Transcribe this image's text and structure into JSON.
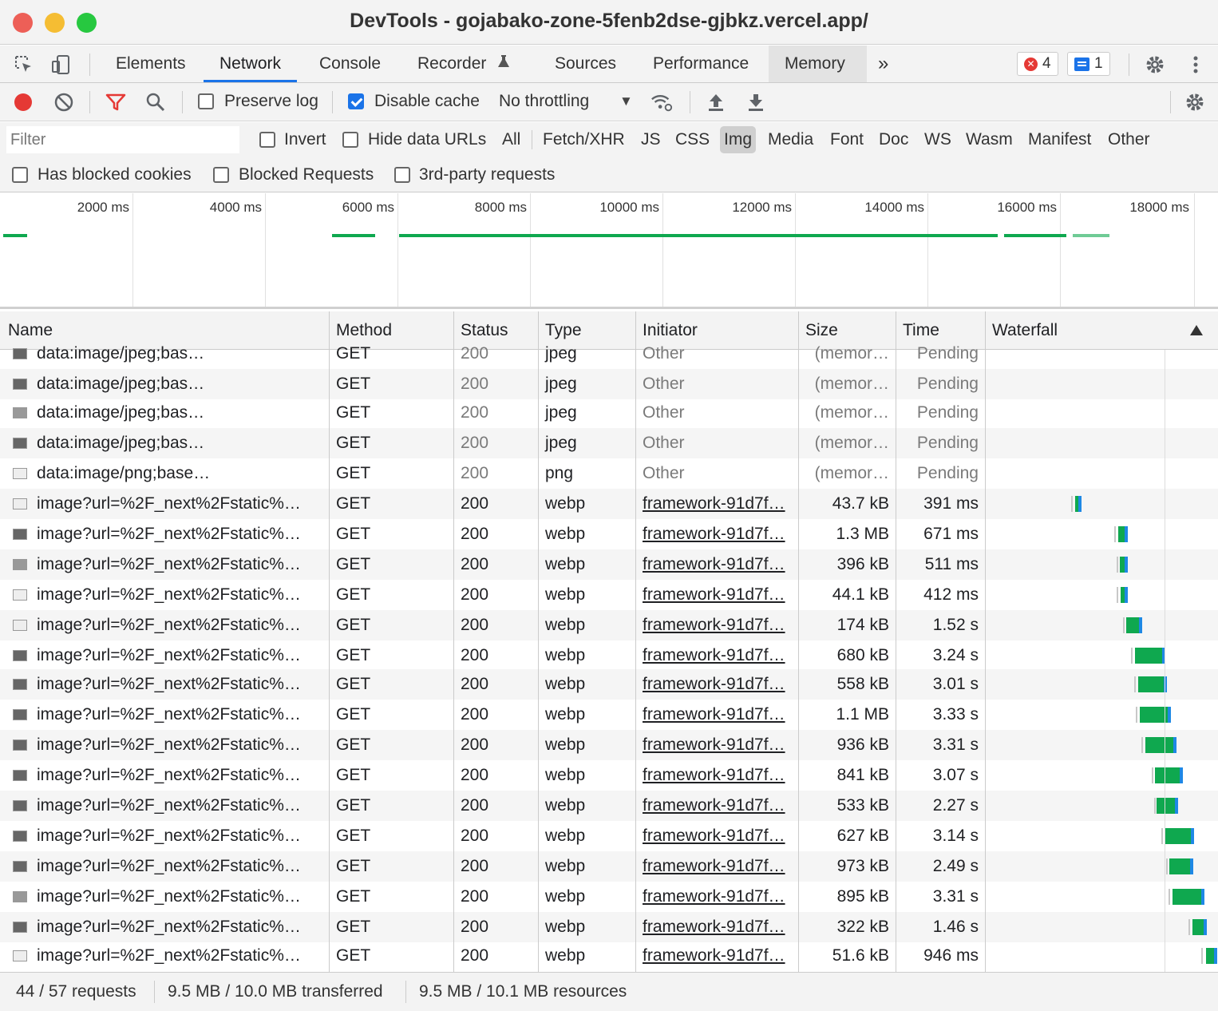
{
  "window": {
    "title": "DevTools - gojabako-zone-5fenb2dse-gjbkz.vercel.app/"
  },
  "tabs": [
    "Elements",
    "Network",
    "Console",
    "Recorder",
    "Sources",
    "Performance",
    "Memory"
  ],
  "tab_active": "Network",
  "more_tabs": "»",
  "badges": {
    "errors": "4",
    "messages": "1"
  },
  "toolbar": {
    "preserve_log": "Preserve log",
    "disable_cache": "Disable cache",
    "throttling": "No throttling",
    "throttle_arrow": "▼"
  },
  "filter": {
    "placeholder": "Filter",
    "invert": "Invert",
    "hide_data_urls": "Hide data URLs",
    "types": [
      "All",
      "Fetch/XHR",
      "JS",
      "CSS",
      "Img",
      "Media",
      "Font",
      "Doc",
      "WS",
      "Wasm",
      "Manifest",
      "Other"
    ],
    "active_type": "Img",
    "has_blocked_cookies": "Has blocked cookies",
    "blocked_requests": "Blocked Requests",
    "third_party": "3rd-party requests"
  },
  "overview_ticks": [
    "2000 ms",
    "4000 ms",
    "6000 ms",
    "8000 ms",
    "10000 ms",
    "12000 ms",
    "14000 ms",
    "16000 ms",
    "18000 ms"
  ],
  "columns": [
    "Name",
    "Method",
    "Status",
    "Type",
    "Initiator",
    "Size",
    "Time",
    "Waterfall"
  ],
  "rows": [
    {
      "name": "data:image/jpeg;bas…",
      "method": "GET",
      "status": "200",
      "type": "jpeg",
      "initiator": "Other",
      "size": "(memor…",
      "time": "Pending",
      "thumb": "dark"
    },
    {
      "name": "data:image/jpeg;bas…",
      "method": "GET",
      "status": "200",
      "type": "jpeg",
      "initiator": "Other",
      "size": "(memor…",
      "time": "Pending",
      "thumb": "dark"
    },
    {
      "name": "data:image/jpeg;bas…",
      "method": "GET",
      "status": "200",
      "type": "jpeg",
      "initiator": "Other",
      "size": "(memor…",
      "time": "Pending",
      "thumb": "mid"
    },
    {
      "name": "data:image/jpeg;bas…",
      "method": "GET",
      "status": "200",
      "type": "jpeg",
      "initiator": "Other",
      "size": "(memor…",
      "time": "Pending",
      "thumb": "dark"
    },
    {
      "name": "data:image/png;base…",
      "method": "GET",
      "status": "200",
      "type": "png",
      "initiator": "Other",
      "size": "(memor…",
      "time": "Pending",
      "thumb": "light"
    },
    {
      "name": "image?url=%2F_next%2Fstatic%…",
      "method": "GET",
      "status": "200",
      "type": "webp",
      "initiator": "framework-91d7f…",
      "size": "43.7 kB",
      "time": "391 ms",
      "thumb": "light"
    },
    {
      "name": "image?url=%2F_next%2Fstatic%…",
      "method": "GET",
      "status": "200",
      "type": "webp",
      "initiator": "framework-91d7f…",
      "size": "1.3 MB",
      "time": "671 ms",
      "thumb": "dark"
    },
    {
      "name": "image?url=%2F_next%2Fstatic%…",
      "method": "GET",
      "status": "200",
      "type": "webp",
      "initiator": "framework-91d7f…",
      "size": "396 kB",
      "time": "511 ms",
      "thumb": "mid"
    },
    {
      "name": "image?url=%2F_next%2Fstatic%…",
      "method": "GET",
      "status": "200",
      "type": "webp",
      "initiator": "framework-91d7f…",
      "size": "44.1 kB",
      "time": "412 ms",
      "thumb": "light"
    },
    {
      "name": "image?url=%2F_next%2Fstatic%…",
      "method": "GET",
      "status": "200",
      "type": "webp",
      "initiator": "framework-91d7f…",
      "size": "174 kB",
      "time": "1.52 s",
      "thumb": "light"
    },
    {
      "name": "image?url=%2F_next%2Fstatic%…",
      "method": "GET",
      "status": "200",
      "type": "webp",
      "initiator": "framework-91d7f…",
      "size": "680 kB",
      "time": "3.24 s",
      "thumb": "dark"
    },
    {
      "name": "image?url=%2F_next%2Fstatic%…",
      "method": "GET",
      "status": "200",
      "type": "webp",
      "initiator": "framework-91d7f…",
      "size": "558 kB",
      "time": "3.01 s",
      "thumb": "dark"
    },
    {
      "name": "image?url=%2F_next%2Fstatic%…",
      "method": "GET",
      "status": "200",
      "type": "webp",
      "initiator": "framework-91d7f…",
      "size": "1.1 MB",
      "time": "3.33 s",
      "thumb": "dark"
    },
    {
      "name": "image?url=%2F_next%2Fstatic%…",
      "method": "GET",
      "status": "200",
      "type": "webp",
      "initiator": "framework-91d7f…",
      "size": "936 kB",
      "time": "3.31 s",
      "thumb": "dark"
    },
    {
      "name": "image?url=%2F_next%2Fstatic%…",
      "method": "GET",
      "status": "200",
      "type": "webp",
      "initiator": "framework-91d7f…",
      "size": "841 kB",
      "time": "3.07 s",
      "thumb": "dark"
    },
    {
      "name": "image?url=%2F_next%2Fstatic%…",
      "method": "GET",
      "status": "200",
      "type": "webp",
      "initiator": "framework-91d7f…",
      "size": "533 kB",
      "time": "2.27 s",
      "thumb": "dark"
    },
    {
      "name": "image?url=%2F_next%2Fstatic%…",
      "method": "GET",
      "status": "200",
      "type": "webp",
      "initiator": "framework-91d7f…",
      "size": "627 kB",
      "time": "3.14 s",
      "thumb": "dark"
    },
    {
      "name": "image?url=%2F_next%2Fstatic%…",
      "method": "GET",
      "status": "200",
      "type": "webp",
      "initiator": "framework-91d7f…",
      "size": "973 kB",
      "time": "2.49 s",
      "thumb": "dark"
    },
    {
      "name": "image?url=%2F_next%2Fstatic%…",
      "method": "GET",
      "status": "200",
      "type": "webp",
      "initiator": "framework-91d7f…",
      "size": "895 kB",
      "time": "3.31 s",
      "thumb": "mid"
    },
    {
      "name": "image?url=%2F_next%2Fstatic%…",
      "method": "GET",
      "status": "200",
      "type": "webp",
      "initiator": "framework-91d7f…",
      "size": "322 kB",
      "time": "1.46 s",
      "thumb": "dark"
    },
    {
      "name": "image?url=%2F_next%2Fstatic%…",
      "method": "GET",
      "status": "200",
      "type": "webp",
      "initiator": "framework-91d7f…",
      "size": "51.6 kB",
      "time": "946 ms",
      "thumb": "light"
    }
  ],
  "status_bar": {
    "requests": "44 / 57 requests",
    "transferred": "9.5 MB / 10.0 MB transferred",
    "resources": "9.5 MB / 10.1 MB resources"
  },
  "colors": {
    "accent": "#1a73e8",
    "record": "#e53935",
    "waterfall_green": "#0fa84f",
    "waterfall_blue": "#1e88e5"
  },
  "icons": [
    "inspect-element-icon",
    "device-toolbar-icon",
    "more-tabs-icon",
    "error-icon",
    "message-icon",
    "settings-gear-icon",
    "kebab-menu-icon",
    "record-icon",
    "clear-icon",
    "filter-funnel-icon",
    "search-icon",
    "network-conditions-icon",
    "import-har-icon",
    "export-har-icon",
    "network-settings-gear-icon",
    "sort-ascending-icon"
  ]
}
